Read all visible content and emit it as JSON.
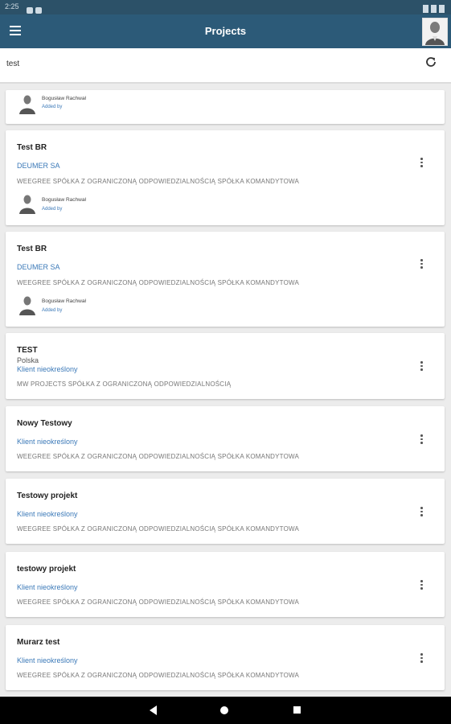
{
  "app": {
    "title": "Projects"
  },
  "status_bar": {
    "time": "2:25"
  },
  "search": {
    "value": "test"
  },
  "partial_card": {
    "user_name": "Bogusław Rachwał",
    "added_by": "Added by"
  },
  "cards": [
    {
      "title": "Test BR",
      "client": "DEUMER SA",
      "company": "WEEGREE SPÓŁKA Z OGRANICZONĄ ODPOWIEDZIALNOŚCIĄ SPÓŁKA KOMANDYTOWA",
      "user_name": "Bogusław Rachwał",
      "added_by": "Added by"
    },
    {
      "title": "Test BR",
      "client": "DEUMER SA",
      "company": "WEEGREE SPÓŁKA Z OGRANICZONĄ ODPOWIEDZIALNOŚCIĄ SPÓŁKA KOMANDYTOWA",
      "user_name": "Bogusław Rachwał",
      "added_by": "Added by"
    },
    {
      "title": "TEST",
      "subtitle": "Polska",
      "client": "Klient nieokreślony",
      "company": "MW PROJECTS SPÓŁKA Z OGRANICZONĄ ODPOWIEDZIALNOŚCIĄ"
    },
    {
      "title": "Nowy Testowy",
      "client": "Klient nieokreślony",
      "company": "WEEGREE SPÓŁKA Z OGRANICZONĄ ODPOWIEDZIALNOŚCIĄ SPÓŁKA KOMANDYTOWA"
    },
    {
      "title": "Testowy projekt",
      "client": "Klient nieokreślony",
      "company": "WEEGREE SPÓŁKA Z OGRANICZONĄ ODPOWIEDZIALNOŚCIĄ SPÓŁKA KOMANDYTOWA"
    },
    {
      "title": "testowy projekt",
      "client": "Klient nieokreślony",
      "company": "WEEGREE SPÓŁKA Z OGRANICZONĄ ODPOWIEDZIALNOŚCIĄ SPÓŁKA KOMANDYTOWA"
    },
    {
      "title": "Murarz test",
      "client": "Klient nieokreślony",
      "company": "WEEGREE SPÓŁKA Z OGRANICZONĄ ODPOWIEDZIALNOŚCIĄ SPÓŁKA KOMANDYTOWA"
    }
  ],
  "colors": {
    "appbar": "#2c5a78",
    "statusbar": "#2c5168",
    "link": "#3b79b8"
  },
  "icons": {
    "menu": "menu-icon",
    "refresh": "refresh-icon",
    "more": "more-vert-icon",
    "back": "back-icon",
    "home": "home-icon",
    "recent": "recent-apps-icon"
  }
}
